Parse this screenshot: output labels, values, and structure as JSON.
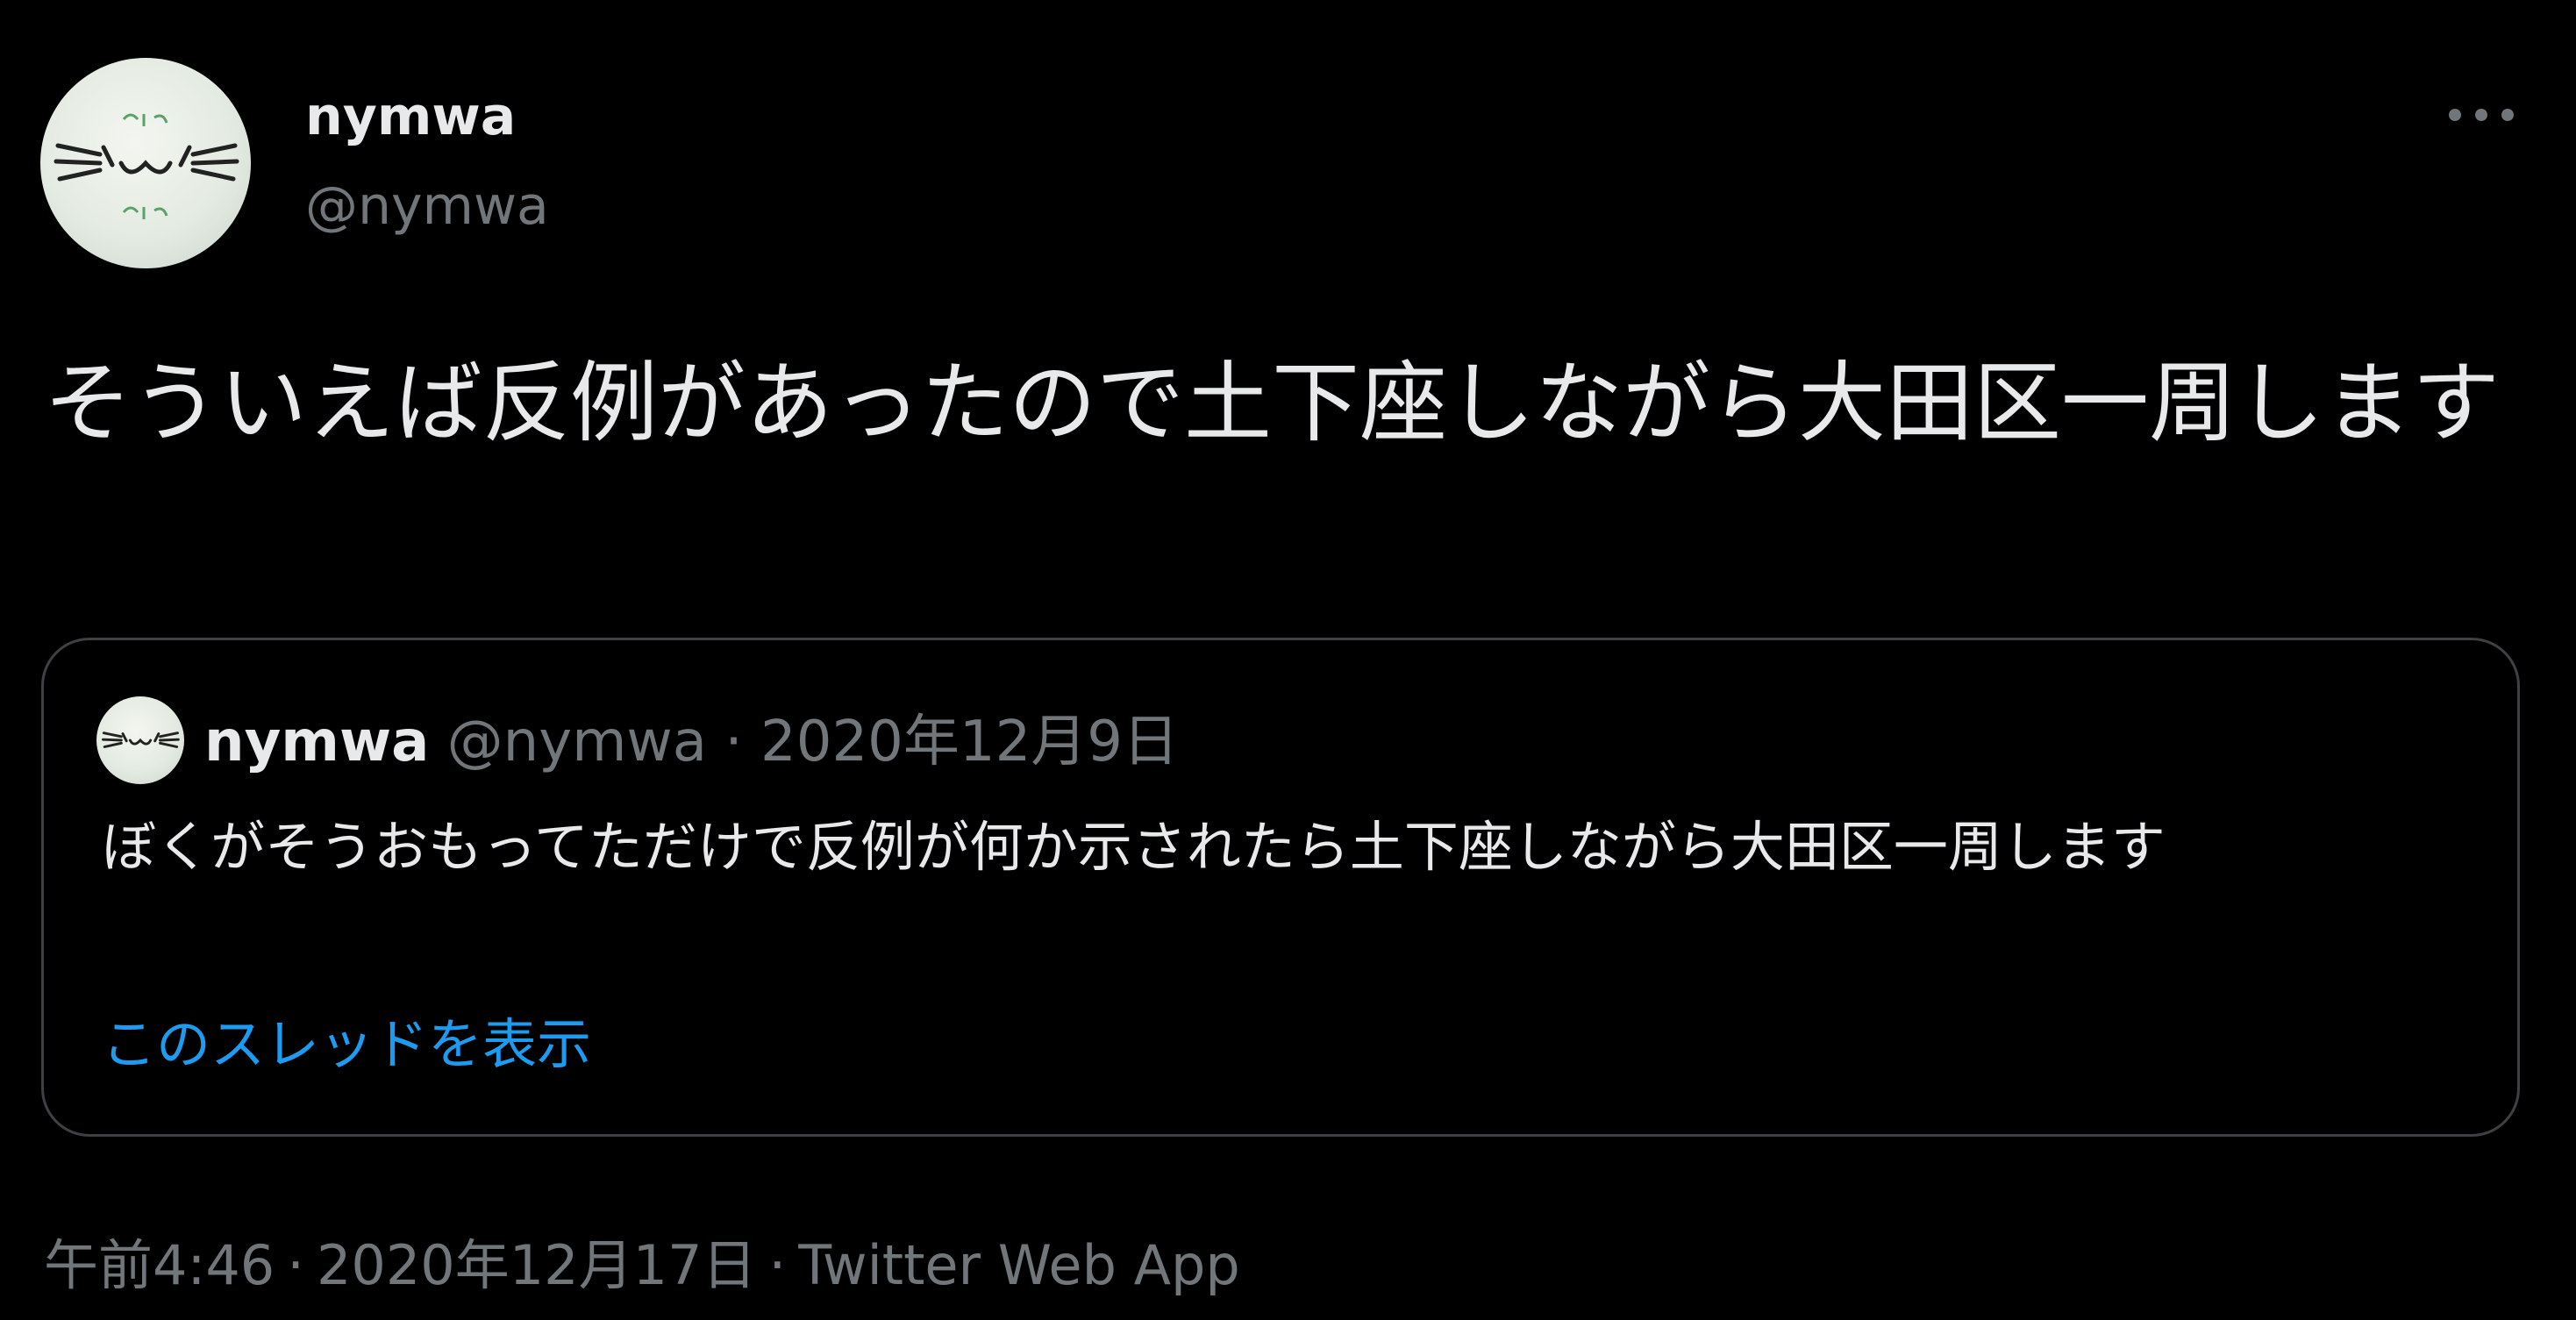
{
  "tweet": {
    "author": {
      "display_name": "nymwa",
      "handle": "@nymwa"
    },
    "text": "そういえば反例があったので土下座しながら大田区一周します",
    "more_icon": "more-horizontal-icon"
  },
  "quote": {
    "display_name": "nymwa",
    "handle": "@nymwa",
    "separator": "·",
    "date": "2020年12月9日",
    "text": "ぼくがそうおもってただけで反例が何か示されたら土下座しながら大田区一周します",
    "thread_link": "このスレッドを表示"
  },
  "footer": {
    "time": "午前4:46",
    "separator": "·",
    "date": "2020年12月17日",
    "source": "Twitter Web App"
  },
  "colors": {
    "background": "#000000",
    "text": "#e7e9ea",
    "secondary": "#71767b",
    "link": "#1d9bf0",
    "border": "#3e4144"
  }
}
